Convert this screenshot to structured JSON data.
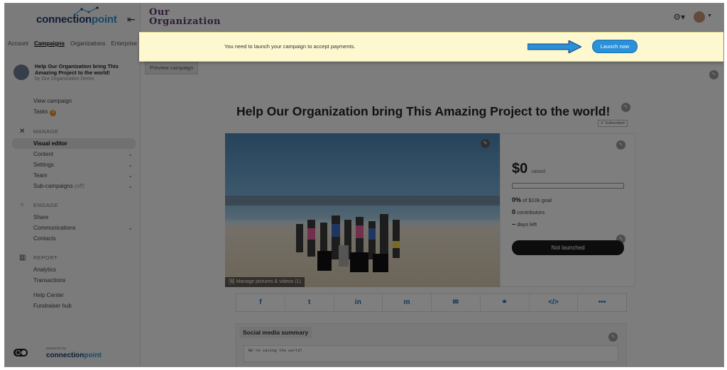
{
  "brand": {
    "name_dark": "connection",
    "name_light": "point",
    "powered_by": "powered by"
  },
  "topnav": [
    "Account",
    "Campaigns",
    "Organizations",
    "Enterprise"
  ],
  "campaign": {
    "title": "Help Our Organization bring This Amazing Project to the world!",
    "by": "by Our Organization Demo"
  },
  "nav_top": {
    "view": "View campaign",
    "tasks": "Tasks",
    "tasks_count": "4"
  },
  "sections": {
    "manage": {
      "label": "MANAGE",
      "items": [
        "Visual editor",
        "Content",
        "Settings",
        "Team",
        "Sub-campaigns"
      ],
      "sub_off": "(off)"
    },
    "engage": {
      "label": "ENGAGE",
      "items": [
        "Share",
        "Communications",
        "Contacts"
      ]
    },
    "report": {
      "label": "REPORT",
      "items": [
        "Analytics",
        "Transactions"
      ]
    }
  },
  "nav_bottom": [
    "Help Center",
    "Fundraiser hub"
  ],
  "header": {
    "org_line1": "Our",
    "org_line2": "Organization"
  },
  "banner": {
    "message": "You need to launch your campaign to accept payments.",
    "button": "Launch now"
  },
  "main": {
    "preview": "Preview campaign",
    "title": "Help Our Organization bring This Amazing Project to the world!",
    "subscribed": "Subscribed",
    "manage_pics": "Manage pictures & videos (1)",
    "raised_amount": "$0",
    "raised_label": "raised",
    "progress": 0,
    "goal_pct": "0%",
    "goal_text": "of $10k goal",
    "contributors_num": "0",
    "contributors_text": "contributors",
    "days_num": "–",
    "days_text": "days left",
    "status_button": "Not launched",
    "social_title": "Social media summary",
    "social_text": "We're saving the world!"
  },
  "share_icons": [
    "facebook-icon",
    "twitter-icon",
    "linkedin-icon",
    "messenger-icon",
    "email-icon",
    "link-icon",
    "embed-icon",
    "more-icon"
  ],
  "share_glyphs": [
    "f",
    "t",
    "in",
    "m",
    "✉",
    "⚭",
    "</>",
    "•••"
  ],
  "colors": {
    "accent": "#2a90d8",
    "banner": "#fdf8d0",
    "org_title": "#5a3a6e",
    "dark_button": "#1b1b1b"
  }
}
